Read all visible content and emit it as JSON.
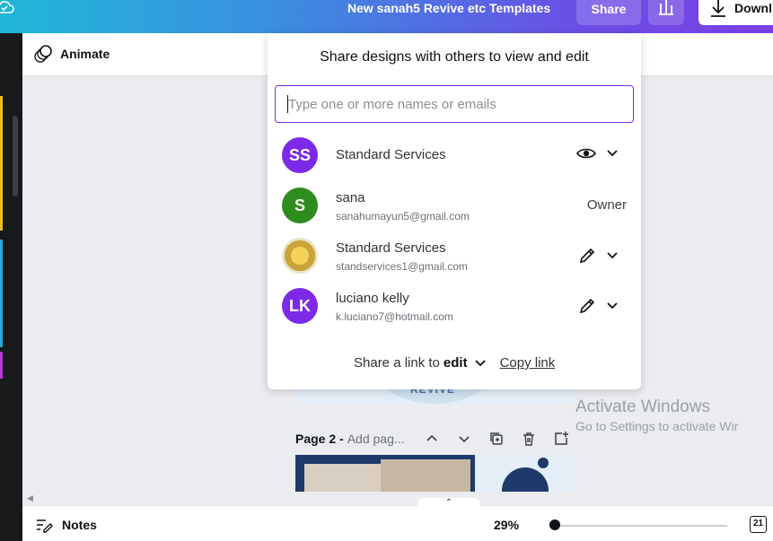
{
  "topbar": {
    "doc_title": "New sanah5 Revive etc Templates",
    "share_label": "Share",
    "download_label": "Downl",
    "gradient_colors": [
      "#1fb7d6",
      "#3a8fe0",
      "#6a4fe6",
      "#7b3fe4"
    ]
  },
  "toolbar": {
    "animate_label": "Animate"
  },
  "share_panel": {
    "title": "Share designs with others to view and edit",
    "input_placeholder": "Type one or more names or emails",
    "members": [
      {
        "initials": "SS",
        "name": "Standard Services",
        "email": "",
        "avatar_color": "#7d2ae8",
        "permission_icon": "eye-icon",
        "role": ""
      },
      {
        "initials": "S",
        "name": "sana",
        "email": "sanahumayun5@gmail.com",
        "avatar_color": "#2e8b1e",
        "permission_icon": "",
        "role": "Owner"
      },
      {
        "initials": "",
        "name": "Standard Services",
        "email": "standservices1@gmail.com",
        "avatar_color": "#d9b84a",
        "permission_icon": "pencil-icon",
        "role": ""
      },
      {
        "initials": "LK",
        "name": "luciano kelly",
        "email": "k.luciano7@hotmail.com",
        "avatar_color": "#7d2ae8",
        "permission_icon": "pencil-icon",
        "role": ""
      }
    ],
    "link_prefix": "Share a link to",
    "link_permission": "edit",
    "copy_link_label": "Copy link",
    "accent_color": "#7d2ae8"
  },
  "canvas": {
    "page1_logo_text": "REVIVE",
    "page2_label": "Page 2 -",
    "page2_title_placeholder": "Add pag..."
  },
  "watermark": {
    "line1": "Activate Windows",
    "line2": "Go to Settings to activate Wir"
  },
  "bottombar": {
    "notes_label": "Notes",
    "zoom": "29%",
    "page_count": "21"
  }
}
